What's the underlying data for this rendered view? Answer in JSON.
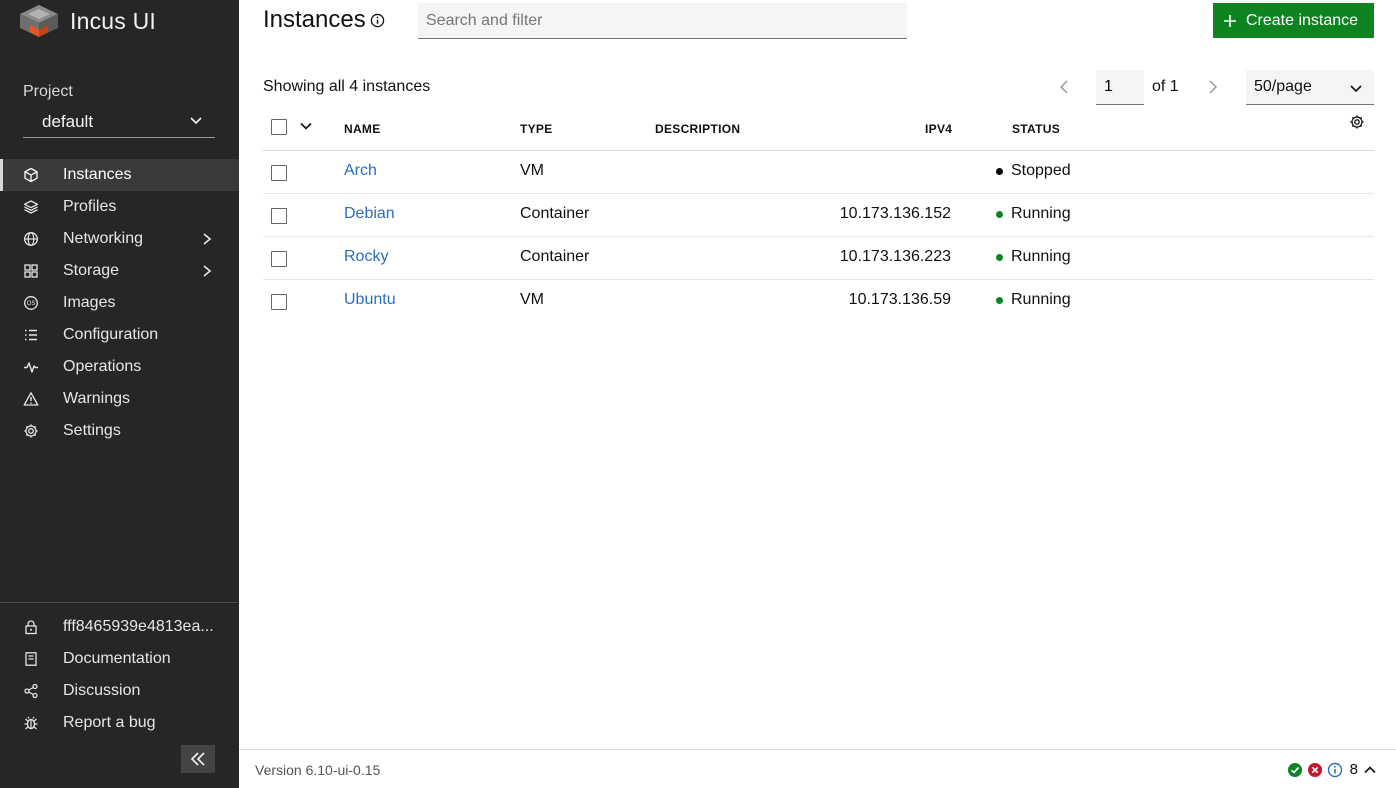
{
  "app": {
    "name": "Incus UI"
  },
  "project": {
    "label": "Project",
    "value": "default"
  },
  "nav": {
    "items": [
      {
        "label": "Instances"
      },
      {
        "label": "Profiles"
      },
      {
        "label": "Networking"
      },
      {
        "label": "Storage"
      },
      {
        "label": "Images"
      },
      {
        "label": "Configuration"
      },
      {
        "label": "Operations"
      },
      {
        "label": "Warnings"
      },
      {
        "label": "Settings"
      }
    ],
    "bottom": [
      {
        "label": "fff8465939e4813ea..."
      },
      {
        "label": "Documentation"
      },
      {
        "label": "Discussion"
      },
      {
        "label": "Report a bug"
      }
    ]
  },
  "header": {
    "title": "Instances",
    "search_placeholder": "Search and filter",
    "create_label": "Create instance"
  },
  "summary": {
    "text": "Showing all 4 instances"
  },
  "pagination": {
    "page": "1",
    "of_text": "of 1",
    "per_page": "50/page"
  },
  "table": {
    "columns": {
      "name": "NAME",
      "type": "TYPE",
      "description": "DESCRIPTION",
      "ipv4": "IPV4",
      "status": "STATUS"
    },
    "rows": [
      {
        "name": "Arch",
        "type": "VM",
        "description": "",
        "ipv4": "",
        "status": "Stopped"
      },
      {
        "name": "Debian",
        "type": "Container",
        "description": "",
        "ipv4": "10.173.136.152",
        "status": "Running"
      },
      {
        "name": "Rocky",
        "type": "Container",
        "description": "",
        "ipv4": "10.173.136.223",
        "status": "Running"
      },
      {
        "name": "Ubuntu",
        "type": "VM",
        "description": "",
        "ipv4": "10.173.136.59",
        "status": "Running"
      }
    ]
  },
  "footer": {
    "version": "Version 6.10-ui-0.15",
    "notification_count": "8"
  },
  "colors": {
    "sidebar_bg": "#262626",
    "accent_green": "#0e8420",
    "link_blue": "#2a6ebb",
    "status_running": "#0e8420",
    "status_stopped": "#000000",
    "error_red": "#c7162b",
    "info_blue": "#2a6ebb"
  },
  "icons": {
    "nav": [
      "instances-icon",
      "profiles-icon",
      "networking-icon",
      "storage-icon",
      "images-icon",
      "configuration-icon",
      "operations-icon",
      "warnings-icon",
      "settings-icon"
    ],
    "bottom": [
      "lock-icon",
      "documentation-icon",
      "discussion-icon",
      "bug-icon"
    ]
  }
}
